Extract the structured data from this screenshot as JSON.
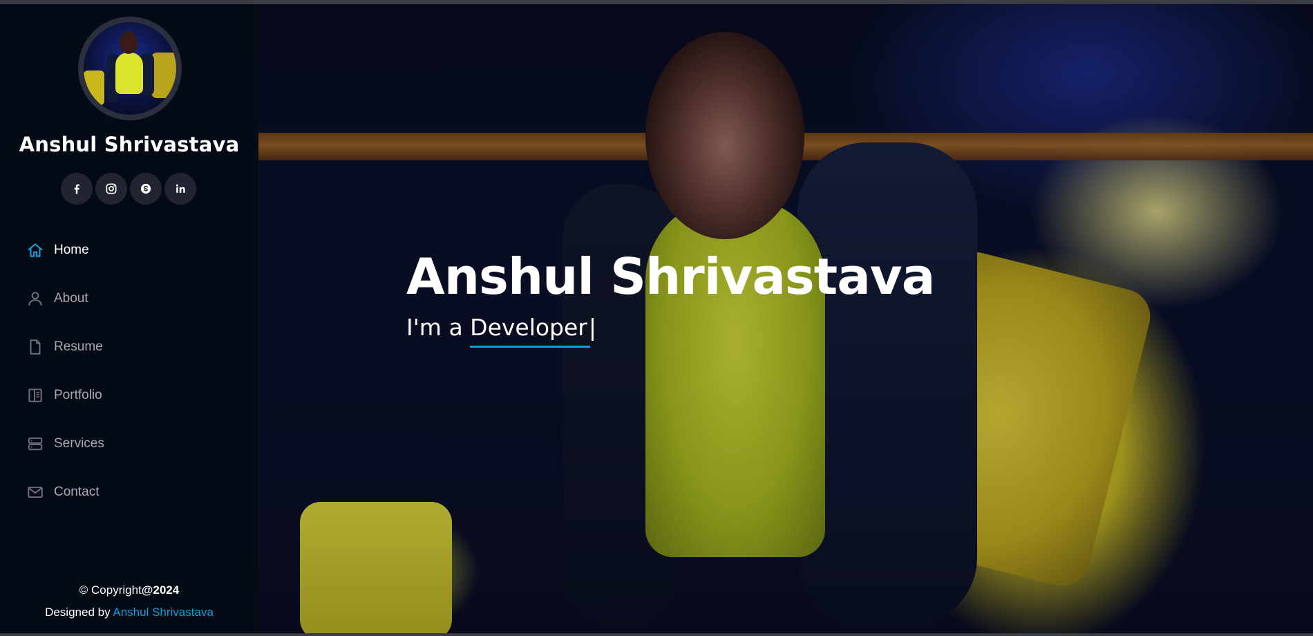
{
  "sidebar": {
    "name": "Anshul Shrivastava",
    "social": [
      {
        "icon": "facebook-icon"
      },
      {
        "icon": "instagram-icon"
      },
      {
        "icon": "skype-icon"
      },
      {
        "icon": "linkedin-icon"
      }
    ],
    "nav": [
      {
        "label": "Home",
        "icon": "home-icon",
        "active": true
      },
      {
        "label": "About",
        "icon": "person-icon",
        "active": false
      },
      {
        "label": "Resume",
        "icon": "file-icon",
        "active": false
      },
      {
        "label": "Portfolio",
        "icon": "book-icon",
        "active": false
      },
      {
        "label": "Services",
        "icon": "server-icon",
        "active": false
      },
      {
        "label": "Contact",
        "icon": "envelope-icon",
        "active": false
      }
    ],
    "copyright_prefix": "© Copyright",
    "copyright_year": "@2024",
    "designed_prefix": "Designed by ",
    "designed_link": "Anshul Shrivastava"
  },
  "hero": {
    "title": "Anshul Shrivastava",
    "subtitle_prefix": "I'm a ",
    "subtitle_typed": "Developer",
    "cursor": "|"
  },
  "colors": {
    "accent": "#149ddd",
    "sidebar_bg": "#040b14",
    "social_bg": "#212431"
  }
}
